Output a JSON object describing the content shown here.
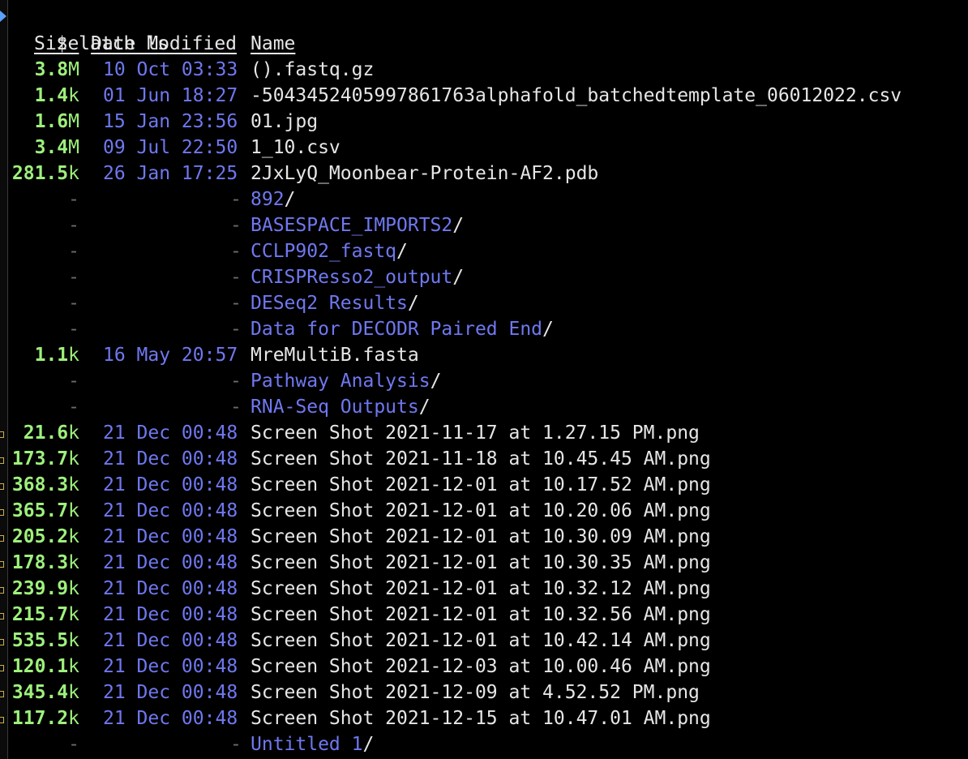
{
  "prompt": {
    "symbol": "$",
    "command": "latch ls"
  },
  "headers": {
    "size": "Size",
    "date": "Date Modified",
    "name": "Name"
  },
  "colors": {
    "size": "#9ef07c",
    "date": "#6f78f0",
    "directory": "#6f78f0",
    "file": "#e6e6e6",
    "background": "#000000"
  },
  "rows": [
    {
      "size_num": "3.8",
      "size_unit": "M",
      "date": "10 Oct 03:33",
      "name": "().fastq.gz",
      "type": "file"
    },
    {
      "size_num": "1.4",
      "size_unit": "k",
      "date": "01 Jun 18:27",
      "name": "-5043452405997861763alphafold_batchedtemplate_06012022.csv",
      "type": "file"
    },
    {
      "size_num": "1.6",
      "size_unit": "M",
      "date": "15 Jan 23:56",
      "name": "01.jpg",
      "type": "file"
    },
    {
      "size_num": "3.4",
      "size_unit": "M",
      "date": "09 Jul 22:50",
      "name": "1_10.csv",
      "type": "file"
    },
    {
      "size_num": "281.5",
      "size_unit": "k",
      "date": "26 Jan 17:25",
      "name": "2JxLyQ_Moonbear-Protein-AF2.pdb",
      "type": "file"
    },
    {
      "size_num": "-",
      "size_unit": "",
      "date": "-",
      "name": "892",
      "type": "dir"
    },
    {
      "size_num": "-",
      "size_unit": "",
      "date": "-",
      "name": "BASESPACE_IMPORTS2",
      "type": "dir"
    },
    {
      "size_num": "-",
      "size_unit": "",
      "date": "-",
      "name": "CCLP902_fastq",
      "type": "dir"
    },
    {
      "size_num": "-",
      "size_unit": "",
      "date": "-",
      "name": "CRISPResso2_output",
      "type": "dir"
    },
    {
      "size_num": "-",
      "size_unit": "",
      "date": "-",
      "name": "DESeq2 Results",
      "type": "dir"
    },
    {
      "size_num": "-",
      "size_unit": "",
      "date": "-",
      "name": "Data for DECODR Paired End",
      "type": "dir"
    },
    {
      "size_num": "1.1",
      "size_unit": "k",
      "date": "16 May 20:57",
      "name": "MreMultiB.fasta",
      "type": "file"
    },
    {
      "size_num": "-",
      "size_unit": "",
      "date": "-",
      "name": "Pathway Analysis",
      "type": "dir"
    },
    {
      "size_num": "-",
      "size_unit": "",
      "date": "-",
      "name": "RNA-Seq Outputs",
      "type": "dir"
    },
    {
      "size_num": "21.6",
      "size_unit": "k",
      "date": "21 Dec 00:48",
      "name": "Screen Shot 2021-11-17 at 1.27.15 PM.png",
      "type": "file"
    },
    {
      "size_num": "173.7",
      "size_unit": "k",
      "date": "21 Dec 00:48",
      "name": "Screen Shot 2021-11-18 at 10.45.45 AM.png",
      "type": "file"
    },
    {
      "size_num": "368.3",
      "size_unit": "k",
      "date": "21 Dec 00:48",
      "name": "Screen Shot 2021-12-01 at 10.17.52 AM.png",
      "type": "file"
    },
    {
      "size_num": "365.7",
      "size_unit": "k",
      "date": "21 Dec 00:48",
      "name": "Screen Shot 2021-12-01 at 10.20.06 AM.png",
      "type": "file"
    },
    {
      "size_num": "205.2",
      "size_unit": "k",
      "date": "21 Dec 00:48",
      "name": "Screen Shot 2021-12-01 at 10.30.09 AM.png",
      "type": "file"
    },
    {
      "size_num": "178.3",
      "size_unit": "k",
      "date": "21 Dec 00:48",
      "name": "Screen Shot 2021-12-01 at 10.30.35 AM.png",
      "type": "file"
    },
    {
      "size_num": "239.9",
      "size_unit": "k",
      "date": "21 Dec 00:48",
      "name": "Screen Shot 2021-12-01 at 10.32.12 AM.png",
      "type": "file"
    },
    {
      "size_num": "215.7",
      "size_unit": "k",
      "date": "21 Dec 00:48",
      "name": "Screen Shot 2021-12-01 at 10.32.56 AM.png",
      "type": "file"
    },
    {
      "size_num": "535.5",
      "size_unit": "k",
      "date": "21 Dec 00:48",
      "name": "Screen Shot 2021-12-01 at 10.42.14 AM.png",
      "type": "file"
    },
    {
      "size_num": "120.1",
      "size_unit": "k",
      "date": "21 Dec 00:48",
      "name": "Screen Shot 2021-12-03 at 10.00.46 AM.png",
      "type": "file"
    },
    {
      "size_num": "345.4",
      "size_unit": "k",
      "date": "21 Dec 00:48",
      "name": "Screen Shot 2021-12-09 at 4.52.52 PM.png",
      "type": "file"
    },
    {
      "size_num": "117.2",
      "size_unit": "k",
      "date": "21 Dec 00:48",
      "name": "Screen Shot 2021-12-15 at 10.47.01 AM.png",
      "type": "file"
    },
    {
      "size_num": "-",
      "size_unit": "",
      "date": "-",
      "name": "Untitled 1",
      "type": "dir"
    }
  ]
}
